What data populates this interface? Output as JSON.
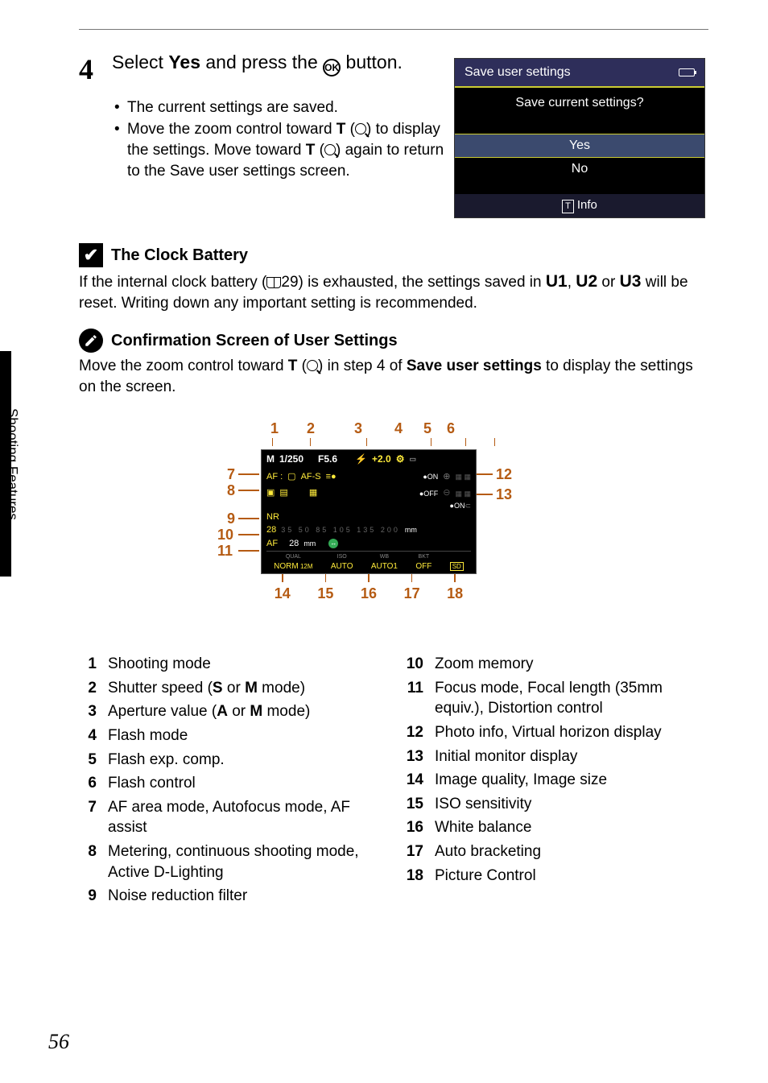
{
  "step": {
    "number": "4",
    "title_pre": "Select ",
    "title_bold": "Yes",
    "title_mid": " and press the ",
    "title_ok": "OK",
    "title_post": " button.",
    "bullet1": "The current settings are saved.",
    "bullet2_pre": "Move the zoom control toward ",
    "bullet2_T1": "T",
    "bullet2_mid1": " (",
    "bullet2_mid2": ") to display the settings. Move toward ",
    "bullet2_T2": "T",
    "bullet2_mid3": " (",
    "bullet2_end": ") again to return to the Save user settings screen."
  },
  "dialog": {
    "title": "Save user settings",
    "prompt": "Save current settings?",
    "opt_yes": "Yes",
    "opt_no": "No",
    "foot_t": "T",
    "foot_label": "Info"
  },
  "clock_note": {
    "title": "The Clock Battery",
    "text_pre": "If the internal clock battery (",
    "page_ref": "29",
    "text_mid": ") is exhausted, the settings saved in ",
    "u1": "U1",
    "u_sep1": ", ",
    "u2": "U2",
    "u_sep2": " or ",
    "u3": "U3",
    "text_post": " will be reset. Writing down any important setting is recommended."
  },
  "conf_note": {
    "title": "Confirmation Screen of User Settings",
    "text_pre": "Move the zoom control toward ",
    "text_T": "T",
    "text_mid1": " (",
    "text_mid2": ") in step 4 of ",
    "text_bold": "Save user settings",
    "text_post": " to display the settings on the screen."
  },
  "diagram": {
    "top": {
      "n1": "1",
      "n2": "2",
      "n3": "3",
      "n4": "4",
      "n5": "5",
      "n6": "6"
    },
    "left": {
      "n7": "7",
      "n8": "8",
      "n9": "9",
      "n10": "10",
      "n11": "11"
    },
    "right": {
      "n12": "12",
      "n13": "13"
    },
    "bottom": {
      "n14": "14",
      "n15": "15",
      "n16": "16",
      "n17": "17",
      "n18": "18"
    },
    "screen": {
      "mode": "M",
      "shutter": "1/250",
      "aperture": "F5.6",
      "flash_icon": "⚡",
      "flash_comp": "+2.0",
      "af_label": "AF :",
      "af_mode": "AF-S",
      "on1": "ON",
      "off1": "OFF",
      "nr": "NR",
      "zoom_focal": "28",
      "zoom_marks": "35   50   85   105  135  200",
      "zoom_unit": "mm",
      "af_row": "AF",
      "af_mm": "28",
      "af_unit": "mm",
      "q_lbl": "QUAL",
      "q_val": "NORM",
      "iso_lbl": "ISO",
      "iso_val": "AUTO",
      "wb_lbl": "WB",
      "wb_val": "AUTO1",
      "bkt_lbl": "BKT",
      "bkt_val": "OFF",
      "pc_val": "SD"
    }
  },
  "legend": {
    "left": [
      {
        "n": "1",
        "t": "Shooting mode"
      },
      {
        "n": "2",
        "t_pre": "Shutter speed (",
        "m1": "S",
        "sep": " or ",
        "m2": "M",
        "t_post": " mode)"
      },
      {
        "n": "3",
        "t_pre": "Aperture value (",
        "m1": "A",
        "sep": " or ",
        "m2": "M",
        "t_post": " mode)"
      },
      {
        "n": "4",
        "t": "Flash mode"
      },
      {
        "n": "5",
        "t": "Flash exp. comp."
      },
      {
        "n": "6",
        "t": "Flash control"
      },
      {
        "n": "7",
        "t": "AF area mode, Autofocus mode, AF assist"
      },
      {
        "n": "8",
        "t": "Metering, continuous shooting mode, Active D-Lighting"
      },
      {
        "n": "9",
        "t": "Noise reduction filter"
      }
    ],
    "right": [
      {
        "n": "10",
        "t": "Zoom memory"
      },
      {
        "n": "11",
        "t": "Focus mode, Focal length (35mm equiv.), Distortion control"
      },
      {
        "n": "12",
        "t": "Photo info, Virtual horizon display"
      },
      {
        "n": "13",
        "t": "Initial monitor display"
      },
      {
        "n": "14",
        "t": "Image quality, Image size"
      },
      {
        "n": "15",
        "t": "ISO sensitivity"
      },
      {
        "n": "16",
        "t": "White balance"
      },
      {
        "n": "17",
        "t": "Auto bracketing"
      },
      {
        "n": "18",
        "t": "Picture Control"
      }
    ]
  },
  "side_tab": "Shooting Features",
  "page_number": "56"
}
